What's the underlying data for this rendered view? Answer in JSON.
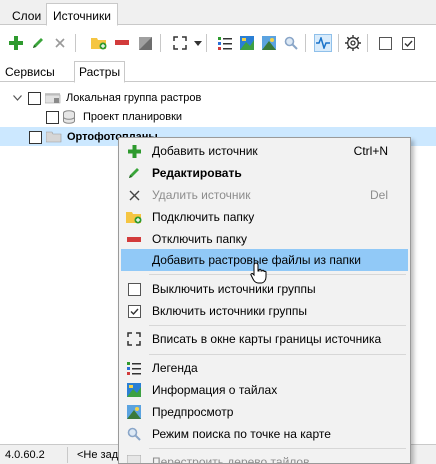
{
  "tabs": {
    "inactive": "Слои",
    "active": "Источники"
  },
  "subtabs": {
    "inactive": "Сервисы",
    "active": "Растры"
  },
  "tree": {
    "group_label": "Локальная группа растров",
    "child_label": "Проект планировки",
    "selected_label": "Ортофотопланы"
  },
  "menu": {
    "items": [
      {
        "label": "Добавить источник",
        "shortcut": "Ctrl+N"
      },
      {
        "label": "Редактировать",
        "shortcut": ""
      },
      {
        "label": "Удалить источник",
        "shortcut": "Del"
      },
      {
        "label": "Подключить папку",
        "shortcut": ""
      },
      {
        "label": "Отключить папку",
        "shortcut": ""
      },
      {
        "label": "Добавить растровые файлы из папки",
        "shortcut": ""
      },
      {
        "label": "Выключить источники группы",
        "shortcut": ""
      },
      {
        "label": "Включить источники группы",
        "shortcut": ""
      },
      {
        "label": "Вписать в окне карты границы источника",
        "shortcut": ""
      },
      {
        "label": "Легенда",
        "shortcut": ""
      },
      {
        "label": "Информация о тайлах",
        "shortcut": ""
      },
      {
        "label": "Предпросмотр",
        "shortcut": ""
      },
      {
        "label": "Режим поиска по точке на карте",
        "shortcut": ""
      },
      {
        "label": "Перестроить дерево тайлов",
        "shortcut": ""
      }
    ]
  },
  "status": {
    "version": "4.0.60.2",
    "text": "<Не зад"
  },
  "colors": {
    "accent": "#91c9f7",
    "selection": "#cce8ff",
    "add_green": "#2e9a2e",
    "remove_red": "#d23b3b"
  }
}
